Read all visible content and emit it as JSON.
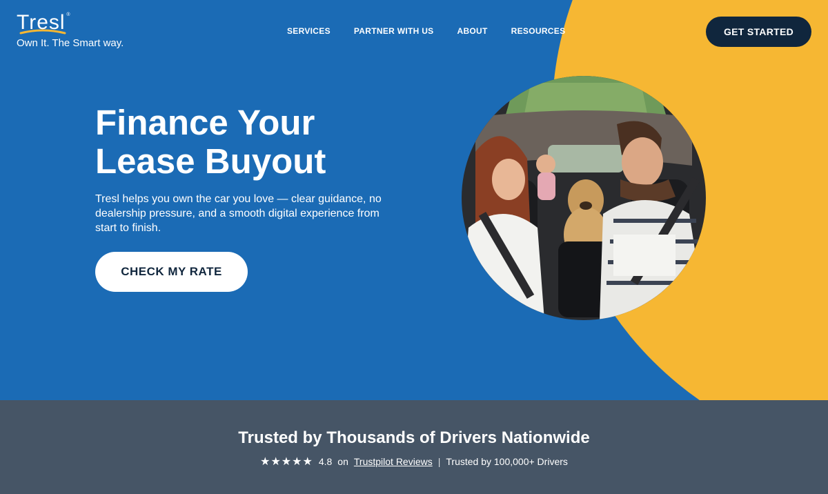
{
  "brand": {
    "logo_text": "Tresl",
    "logo_mark": "®",
    "tagline": "Own It. The Smart way.",
    "colors": {
      "primary_blue": "#1b6bb5",
      "accent_yellow": "#f6b733",
      "navy": "#10263d",
      "slate": "#465566"
    }
  },
  "nav": {
    "items": [
      "SERVICES",
      "PARTNER WITH US",
      "ABOUT",
      "RESOURCES"
    ],
    "cta": "GET STARTED"
  },
  "hero": {
    "headline_line1": "Finance Your",
    "headline_line2": "Lease Buyout",
    "subtext": "Tresl helps you own the car you love — clear guidance, no dealership pressure, and a smooth digital experience from start to finish.",
    "button": "CHECK MY RATE",
    "image_icon": "family-in-car-photo"
  },
  "trust": {
    "title": "Trusted by Thousands of Drivers Nationwide",
    "stars": "★★★★★",
    "rating": "4.8",
    "on": "on",
    "link": "Trustpilot Reviews",
    "separator": "|",
    "drivers": "Trusted by 100,000+ Drivers"
  }
}
